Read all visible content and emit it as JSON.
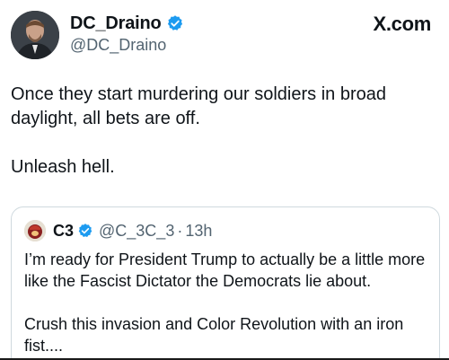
{
  "tweet": {
    "display_name": "DC_Draino",
    "handle": "@DC_Draino",
    "source": "X.com",
    "paragraphs": [
      "Once they start murdering our soldiers in broad daylight, all bets are off.",
      "Unleash hell."
    ]
  },
  "quote": {
    "display_name": "C3",
    "handle": "@C_3C_3",
    "separator": "·",
    "time": "13h",
    "paragraphs": [
      "I’m ready for President Trump to actually be a little more like the Fascist Dictator the Democrats lie about.",
      "Crush this invasion and Color Revolution with an iron fist...."
    ]
  },
  "colors": {
    "verified": "#1d9bf0",
    "secondary_text": "#536471",
    "border": "#cfd9de"
  }
}
